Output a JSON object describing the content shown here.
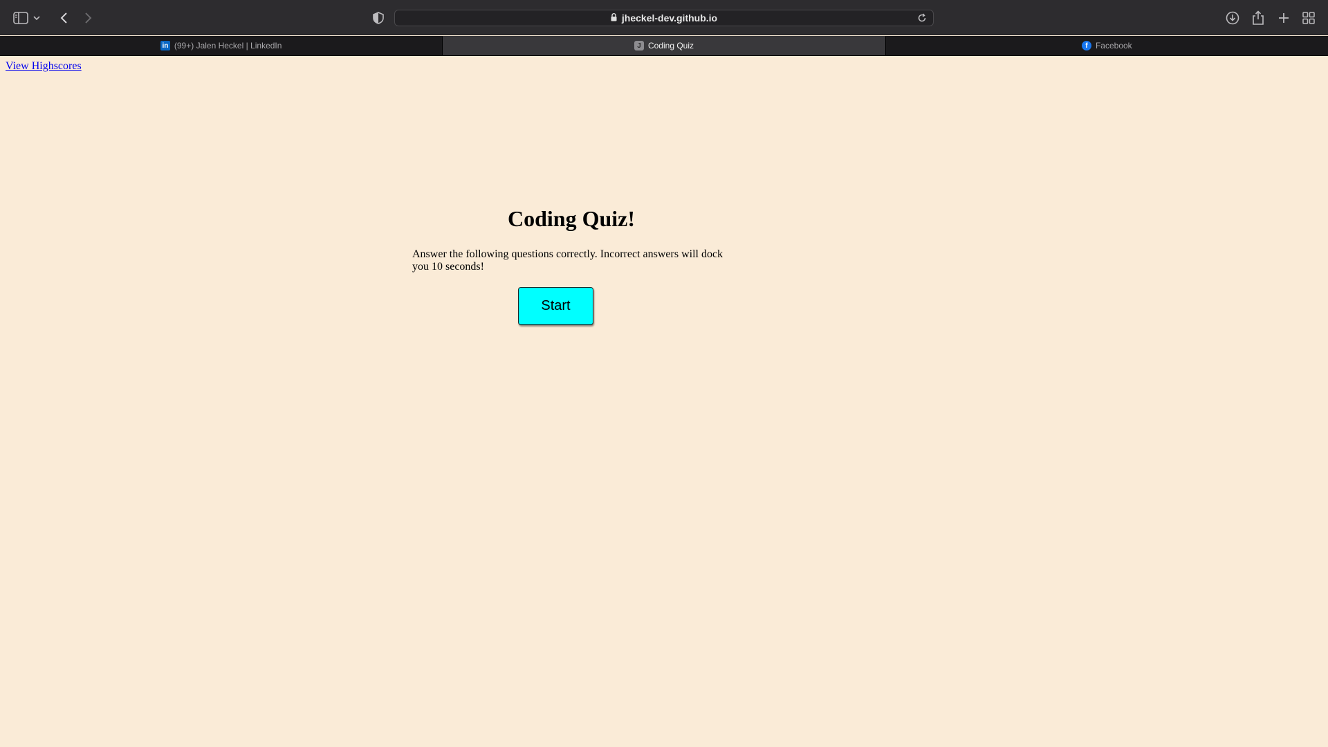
{
  "browser": {
    "url": "jheckel-dev.github.io",
    "tabs": [
      {
        "label": "(99+) Jalen Heckel | LinkedIn",
        "icon": "linkedin-icon",
        "active": false
      },
      {
        "label": "Coding Quiz",
        "icon": "j-favicon",
        "active": true
      },
      {
        "label": "Facebook",
        "icon": "facebook-icon",
        "active": false
      }
    ],
    "toolbar_icons": [
      "sidebar-icon",
      "chevron-down-icon",
      "back-icon",
      "forward-icon",
      "shield-icon",
      "lock-icon",
      "reload-icon",
      "download-icon",
      "share-icon",
      "plus-icon",
      "tab-overview-icon"
    ]
  },
  "page": {
    "highscores_link": "View Highscores",
    "title": "Coding Quiz!",
    "description": "Answer the following questions correctly. Incorrect answers will dock you 10 seconds!",
    "start_button": "Start"
  },
  "colors": {
    "background": "#faebd7",
    "start_button": "#00ffff",
    "link": "#0000ee"
  }
}
